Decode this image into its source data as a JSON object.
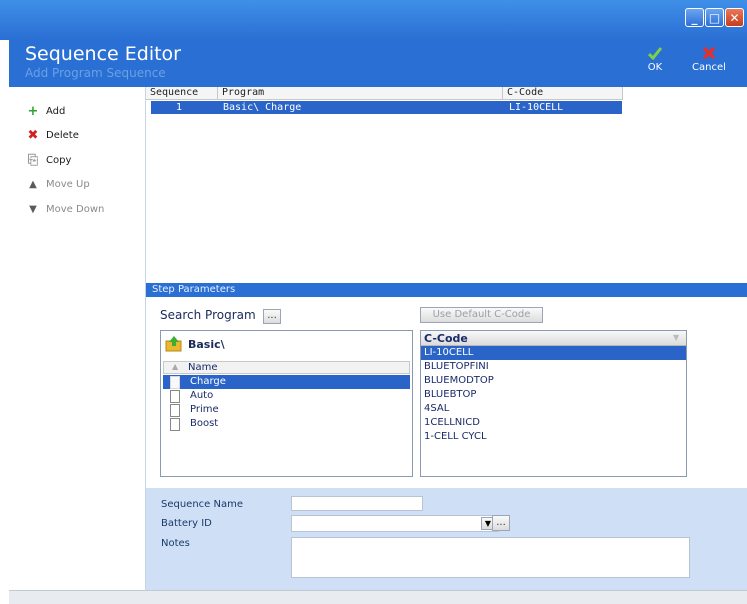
{
  "window": {
    "minimize_glyph": "_",
    "maximize_glyph": "□",
    "close_glyph": "✕"
  },
  "header": {
    "title": "Sequence Editor",
    "subtitle": "Add Program Sequence",
    "ok_label": "OK",
    "cancel_label": "Cancel",
    "ok_icon": "check-icon",
    "cancel_icon": "x-icon"
  },
  "toolbar": {
    "items": [
      {
        "label": "Add",
        "icon": "plus-icon",
        "enabled": true,
        "glyph": "+",
        "color": "#2fa12f"
      },
      {
        "label": "Delete",
        "icon": "delete-x-icon",
        "enabled": true,
        "glyph": "✖",
        "color": "#d02020"
      },
      {
        "label": "Copy",
        "icon": "copy-icon",
        "enabled": false,
        "glyph": "⎘",
        "color": "#9a9a9a"
      },
      {
        "label": "Move Up",
        "icon": "arrow-up-icon",
        "enabled": false,
        "glyph": "▲",
        "color": "#5a5a5a"
      },
      {
        "label": "Move Down",
        "icon": "arrow-down-icon",
        "enabled": false,
        "glyph": "▼",
        "color": "#5a5a5a"
      }
    ]
  },
  "grid": {
    "columns": [
      "Sequence",
      "Program",
      "C-Code"
    ],
    "rows": [
      {
        "sequence": "1",
        "program": "Basic\\ Charge",
        "ccode": "LI-10CELL"
      }
    ]
  },
  "step_params": {
    "title": "Step Parameters",
    "search_label": "Search Program",
    "search_button": "...",
    "default_ccode_button": "Use Default C-Code",
    "folder": "Basic\\",
    "name_header": "Name",
    "programs": [
      "Charge",
      "Auto",
      "Prime",
      "Boost"
    ],
    "selected_program": "Charge",
    "ccode_header": "C-Code",
    "ccodes": [
      "LI-10CELL",
      "BLUETOPFINI",
      "BLUEMODTOP",
      "BLUEBTOP",
      "4SAL",
      "1CELLNICD",
      "1-CELL CYCL"
    ],
    "selected_ccode": "LI-10CELL"
  },
  "form": {
    "sequence_name_label": "Sequence Name",
    "sequence_name_value": "",
    "battery_id_label": "Battery ID",
    "battery_id_value": "",
    "battery_browse": "...",
    "notes_label": "Notes",
    "notes_value": ""
  },
  "colors": {
    "titlebar": "#2a6fd3",
    "selection": "#2a64c8",
    "form_bg": "#cfe0f6"
  }
}
